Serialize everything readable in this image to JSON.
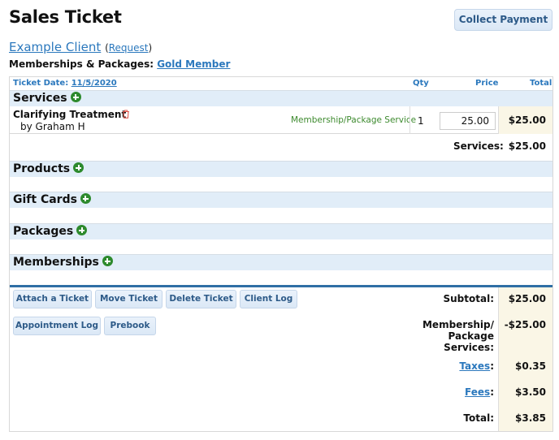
{
  "header": {
    "title": "Sales Ticket",
    "collect_payment_label": "Collect Payment"
  },
  "client": {
    "name": "Example Client",
    "request_open": "(",
    "request_label": "Request",
    "request_close": ")",
    "memberships_label": "Memberships & Packages:",
    "membership_value": "Gold Member"
  },
  "ticket": {
    "date_label": "Ticket Date:",
    "date_value": "11/5/2020",
    "col_qty": "Qty",
    "col_price": "Price",
    "col_total": "Total"
  },
  "sections": {
    "services": "Services",
    "products": "Products",
    "gift_cards": "Gift Cards",
    "packages": "Packages",
    "memberships": "Memberships"
  },
  "service_items": [
    {
      "name": "Clarifying Treatment",
      "by": "by Graham H",
      "type": "Membership/Package Service",
      "qty": "1",
      "price": "25.00",
      "total": "$25.00"
    }
  ],
  "services_subtotal": {
    "label": "Services:",
    "value": "$25.00"
  },
  "actions": {
    "attach_ticket": "Attach a Ticket",
    "move_ticket": "Move Ticket",
    "delete_ticket": "Delete Ticket",
    "client_log": "Client Log",
    "appointment_log": "Appointment Log",
    "prebook": "Prebook"
  },
  "summary": {
    "subtotal_label": "Subtotal:",
    "subtotal_value": "$25.00",
    "membership_label_1": "Membership/",
    "membership_label_2": "Package",
    "membership_label_3": "Services:",
    "membership_value": "-$25.00",
    "taxes_label": "Taxes",
    "taxes_value": "$0.35",
    "fees_label": "Fees",
    "fees_value": "$3.50",
    "colon": ":",
    "total_label": "Total:",
    "total_value": "$3.85"
  },
  "colors": {
    "link": "#2b78bd",
    "section_bg": "#e1edf8",
    "add_icon": "#2d8a2d",
    "delete_icon": "#e05a4f",
    "service_type": "#3d8a2e",
    "totals_bg": "#faf6e6",
    "rule": "#2f6fa5"
  }
}
